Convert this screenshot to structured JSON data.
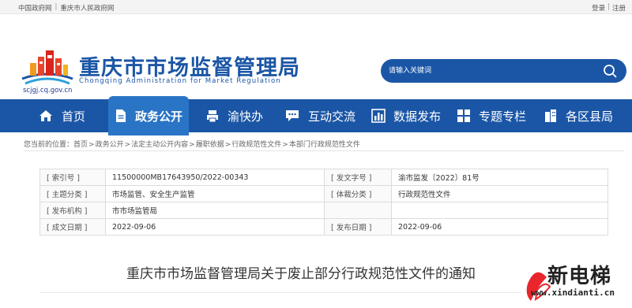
{
  "topbar": {
    "links_left": [
      "中国政府网",
      "重庆市人民政府网"
    ],
    "login": "登录",
    "register": "注册"
  },
  "header": {
    "title": "重庆市市场监督管理局",
    "subtitle": "Chongqing Administration for Market Regulation",
    "domain": "scjgj.cq.gov.cn",
    "search_placeholder": "请输入关键词"
  },
  "nav": {
    "items": [
      {
        "label": "首页",
        "icon": "home-icon"
      },
      {
        "label": "政务公开",
        "icon": "document-icon",
        "active": true
      },
      {
        "label": "渝快办",
        "icon": "printer-icon"
      },
      {
        "label": "互动交流",
        "icon": "chat-icon"
      },
      {
        "label": "数据发布",
        "icon": "chart-icon"
      },
      {
        "label": "专题专栏",
        "icon": "grid-icon"
      },
      {
        "label": "各区县局",
        "icon": "buildings-icon"
      }
    ]
  },
  "breadcrumb": {
    "prefix": "您当前的位置：",
    "items": [
      "首页",
      "政务公开",
      "法定主动公开内容",
      "履职依据",
      "行政规范性文件",
      "本部门行政规范性文件"
    ]
  },
  "meta": {
    "index_label": "[ 索引号 ]",
    "index_value": "11500000MB17643950/2022-00343",
    "docno_label": "[ 发文字号 ]",
    "docno_value": "渝市监发〔2022〕81号",
    "topic_label": "[ 主题分类 ]",
    "topic_value": "市场监管、安全生产监管",
    "genre_label": "[ 体裁分类 ]",
    "genre_value": "行政规范性文件",
    "issuer_label": "[ 发布机构 ]",
    "issuer_value": "市市场监管局",
    "created_label": "[ 成文日期 ]",
    "created_value": "2022-09-06",
    "published_label": "[ 发布日期 ]",
    "published_value": "2022-09-06"
  },
  "document": {
    "title": "重庆市市场监督管理局关于废止部分行政规范性文件的通知"
  },
  "watermark": {
    "text": "新电梯",
    "url": "www.xindianti.cn"
  },
  "colors": {
    "brand_blue": "#1b56a6",
    "nav_active": "#2a74c6"
  }
}
